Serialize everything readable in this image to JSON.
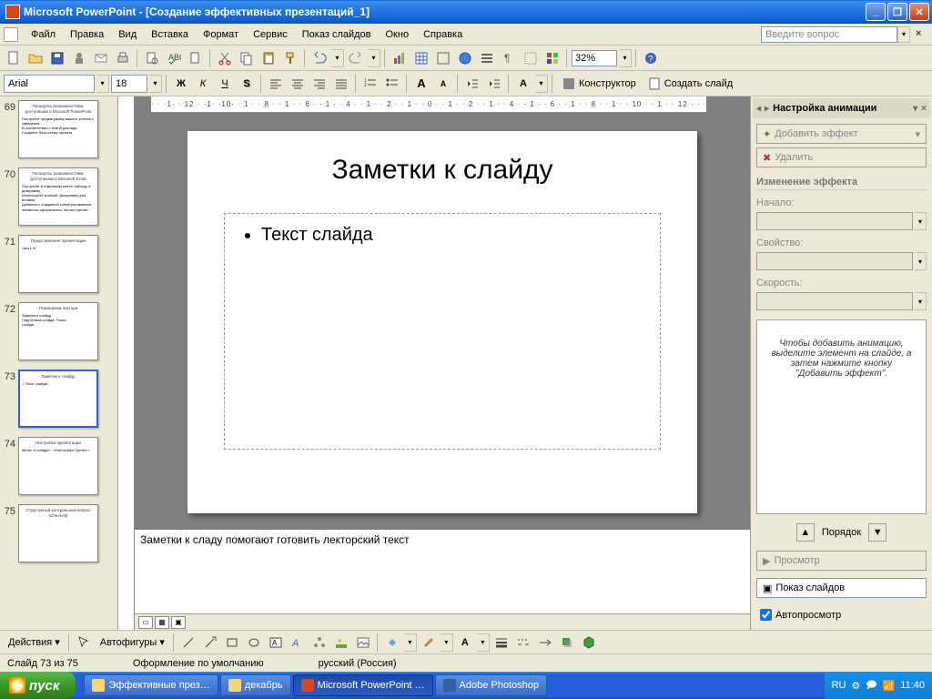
{
  "window": {
    "app": "Microsoft PowerPoint",
    "doc": "[Создание эффективных презентаций_1]"
  },
  "menu": {
    "file": "Файл",
    "edit": "Правка",
    "view": "Вид",
    "insert": "Вставка",
    "format": "Формат",
    "tools": "Сервис",
    "slideshow": "Показ слайдов",
    "window": "Окно",
    "help": "Справка",
    "question_placeholder": "Введите вопрос"
  },
  "toolbar": {
    "zoom": "32%",
    "font": "Arial",
    "size": "18",
    "designer": "Конструктор",
    "newslide": "Создать слайд"
  },
  "ruler_h": "· · ·1· · 12 · ·1· ·10· · 1 · · 8 · · 1 · · 6 · · 1 · · 4 · · 1 · · 2 · · 1 · · 0 · · 1 · · 2 · · 1 · · 4 · · 1 · · 6 · · 1 · · 8 · · 1 · · 10 · · 1 · · 12 · · ·",
  "thumbs": [
    {
      "n": 69,
      "title": "Пользуясь возможностями, доступными в Microsoft PowerPoint",
      "lines": [
        "Постройте оргдиаграмму вашего учебного",
        "заведения",
        "",
        "В соответствии с темой доклада.",
        "Создайте блок-схему проекта"
      ]
    },
    {
      "n": 70,
      "title": "Пользуясь возможностями, доступными в Microsoft Excel",
      "lines": [
        "Постройте в отдельном месте таблицу и",
        "диаграмму",
        "Используйте кнопкой .Диаграмму для",
        "вставки",
        "Добавьте к созданной схеме рисованные",
        "элементы-оформления, линии,стрелки"
      ]
    },
    {
      "n": 71,
      "title": "Представление презентации",
      "lines": [
        "",
        "Часть IV"
      ]
    },
    {
      "n": 72,
      "title": "Помощники лектора",
      "lines": [
        "Заметки к слайду",
        "Подготовка слайда: Показ",
        "слайда"
      ]
    },
    {
      "n": 73,
      "title": "Заметки к слайду",
      "lines": [
        "• Текст слайда"
      ]
    },
    {
      "n": 74,
      "title": "Настройка презентации",
      "lines": [
        "Меню «Слайды» - «Настройка Презен.»"
      ]
    },
    {
      "n": 75,
      "title": "Структурный контрольный вопрос (CheckAll)",
      "lines": [
        ""
      ]
    }
  ],
  "selected_thumb": 73,
  "slide": {
    "title": "Заметки к слайду",
    "bullet1": "Текст слайда"
  },
  "notes": "Заметки к сладу помогают готовить лекторский текст",
  "taskpane": {
    "title": "Настройка анимации",
    "add_effect": "Добавить эффект",
    "delete": "Удалить",
    "change_effect": "Изменение эффекта",
    "start": "Начало:",
    "property": "Свойство:",
    "speed": "Скорость:",
    "hint": "Чтобы добавить анимацию, выделите элемент на слайде, а затем нажмите кнопку \"Добавить эффект\".",
    "order": "Порядок",
    "preview": "Просмотр",
    "slideshow": "Показ слайдов",
    "autopreview": "Автопросмотр"
  },
  "drawbar": {
    "actions": "Действия",
    "autoshapes": "Автофигуры"
  },
  "statusbar": {
    "slide": "Слайд 73 из 75",
    "design": "Оформление по умолчанию",
    "lang": "русский (Россия)"
  },
  "taskbar": {
    "start": "пуск",
    "items": [
      "Эффективные през…",
      "декабрь",
      "Microsoft PowerPoint …",
      "Adobe Photoshop"
    ],
    "lang": "RU",
    "time": "11:40"
  }
}
